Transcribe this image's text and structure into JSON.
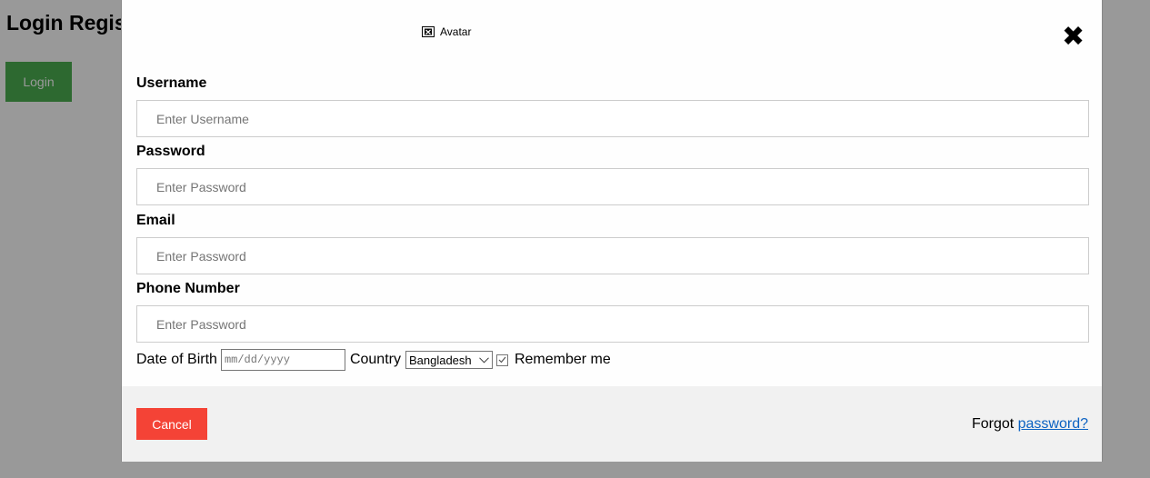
{
  "background": {
    "title": "Login Regis",
    "login_button": "Login"
  },
  "modal": {
    "avatar_alt": "Avatar",
    "close_glyph": "✖",
    "username": {
      "label": "Username",
      "placeholder": "Enter Username"
    },
    "password": {
      "label": "Password",
      "placeholder": "Enter Password"
    },
    "email": {
      "label": "Email",
      "placeholder": "Enter Password"
    },
    "phone": {
      "label": "Phone Number",
      "placeholder": "Enter Password"
    },
    "dob": {
      "label": "Date of Birth",
      "placeholder": "mm/dd/yyyy"
    },
    "country": {
      "label": "Country",
      "selected": "Bangladesh"
    },
    "remember": {
      "label": "Remember me",
      "checked": true
    },
    "footer": {
      "cancel": "Cancel",
      "forgot_text": "Forgot ",
      "forgot_link": "password?"
    }
  },
  "colors": {
    "login_button": "#4caf50",
    "cancel_button": "#f44336",
    "link": "#0b62c2",
    "footer_bg": "#f1f1f1"
  }
}
